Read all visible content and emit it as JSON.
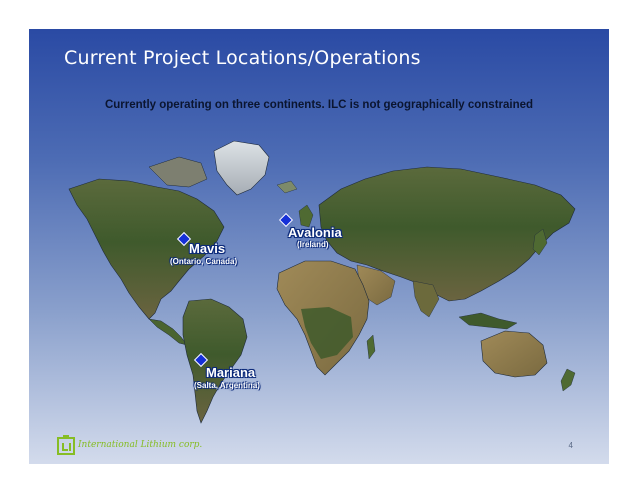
{
  "slide": {
    "title": "Current Project Locations/Operations",
    "subtitle": "Currently operating on three continents. ILC is not geographically constrained",
    "page_number": "4"
  },
  "map": {
    "markers": [
      {
        "name": "Mavis",
        "location": "(Ontario, Canada)"
      },
      {
        "name": "Avalonia",
        "location": "(Ireland)"
      },
      {
        "name": "Mariana",
        "location": "(Salta, Argentina)"
      }
    ]
  },
  "footer": {
    "logo_text": "International Lithium corp."
  },
  "colors": {
    "slide_top": "#2a4aa4",
    "slide_bottom": "#d3dbec",
    "marker": "#1530d8",
    "logo_green": "#86bd24"
  }
}
